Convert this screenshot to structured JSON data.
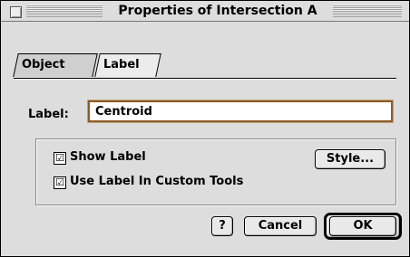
{
  "window": {
    "title": "Properties of Intersection A"
  },
  "tabs": [
    {
      "label": "Object",
      "active": false
    },
    {
      "label": "Label",
      "active": true
    }
  ],
  "label_field": {
    "caption": "Label:",
    "value": "Centroid"
  },
  "options": {
    "show_label": {
      "text": "Show Label",
      "checked": true,
      "mark": "☑"
    },
    "use_label_custom_tools": {
      "text": "Use Label In Custom Tools",
      "checked": true,
      "mark": "☑"
    }
  },
  "buttons": {
    "style": "Style...",
    "help": "?",
    "cancel": "Cancel",
    "ok": "OK"
  },
  "colors": {
    "window_bg": "#dddddd",
    "focus_ring": "#8a5c2a"
  },
  "icons": {
    "close": "close-box-icon",
    "checkbox": "checkbox-checked-icon"
  }
}
